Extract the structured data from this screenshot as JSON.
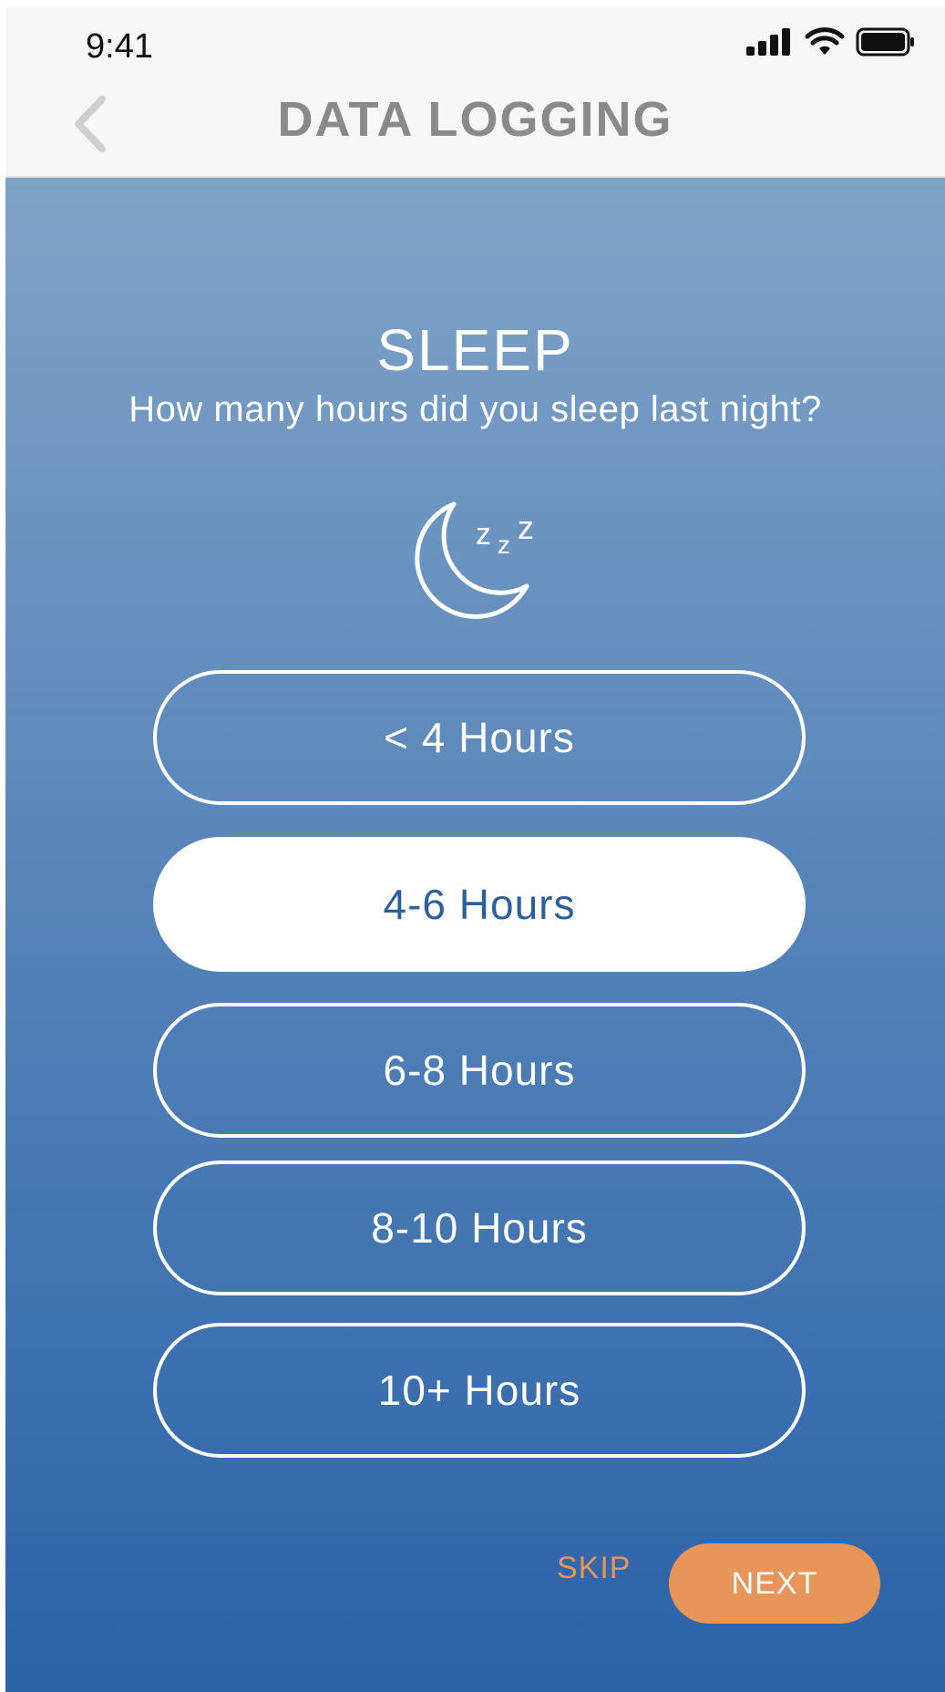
{
  "status_bar": {
    "time": "9:41",
    "icons": [
      "cellular-signal-icon",
      "wifi-icon",
      "battery-icon"
    ]
  },
  "nav": {
    "title": "DATA LOGGING",
    "back_icon": "chevron-left-icon"
  },
  "main": {
    "heading": "SLEEP",
    "question": "How many hours did you sleep last night?",
    "icon": "moon-zzz-icon",
    "options": [
      {
        "label": "< 4 Hours",
        "selected": false
      },
      {
        "label": "4-6 Hours",
        "selected": true
      },
      {
        "label": "6-8 Hours",
        "selected": false
      },
      {
        "label": "8-10 Hours",
        "selected": false
      },
      {
        "label": "10+ Hours",
        "selected": false
      }
    ]
  },
  "footer": {
    "skip_label": "SKIP",
    "next_label": "NEXT"
  },
  "colors": {
    "accent": "#e8955a",
    "selected_text": "#2c5f9e",
    "gradient_top": "#80a3c8",
    "gradient_bottom": "#2b62a8",
    "title_gray": "#8a8a8a"
  }
}
